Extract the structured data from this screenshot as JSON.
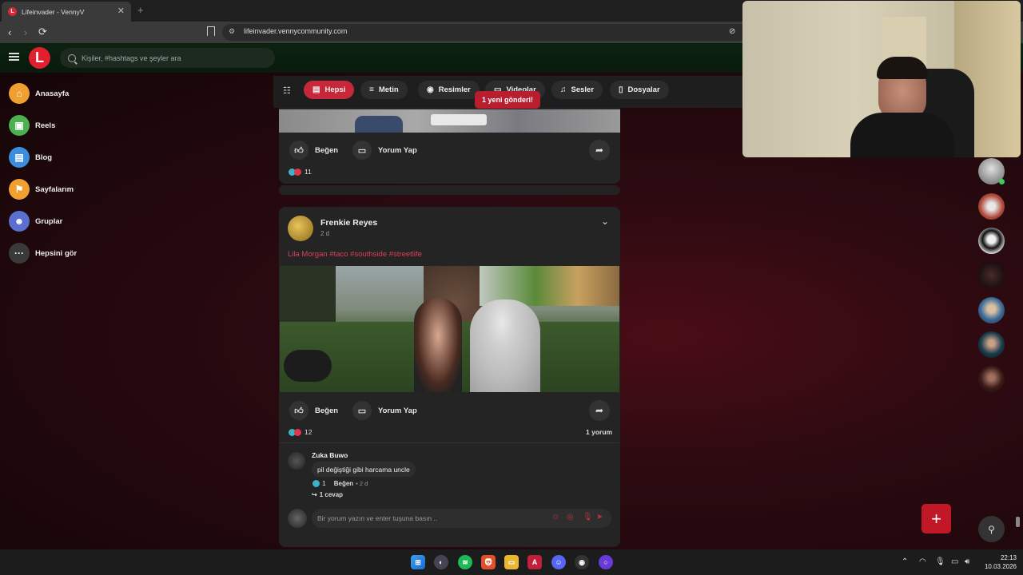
{
  "browser": {
    "tab_title": "Lifeinvader - VennyV",
    "tab_close": "✕",
    "new_tab": "+",
    "url": "lifeinvader.vennycommunity.com"
  },
  "header": {
    "logo": "L",
    "search_placeholder": "Kişiler, #hashtags ve şeyler ara"
  },
  "sidebar": {
    "items": [
      {
        "label": "Anasayfa",
        "icon": "home-icon",
        "color": "#f0a030"
      },
      {
        "label": "Reels",
        "icon": "reels-icon",
        "color": "#4caf50"
      },
      {
        "label": "Blog",
        "icon": "blog-icon",
        "color": "#3b8de0"
      },
      {
        "label": "Sayfalarım",
        "icon": "flag-icon",
        "color": "#f0a030"
      },
      {
        "label": "Gruplar",
        "icon": "groups-icon",
        "color": "#5b6fd0"
      },
      {
        "label": "Hepsini gör",
        "icon": "more-icon",
        "color": "#3a3a3a"
      }
    ]
  },
  "filters": {
    "chips": [
      {
        "label": "Hepsi",
        "icon": "▤"
      },
      {
        "label": "Metin",
        "icon": "≡"
      },
      {
        "label": "Resimler",
        "icon": "◉"
      },
      {
        "label": "Videolar",
        "icon": "▭"
      },
      {
        "label": "Sesler",
        "icon": "♫"
      },
      {
        "label": "Dosyalar",
        "icon": "▯"
      }
    ],
    "new_post_notice": "1 yeni gönderi!"
  },
  "post1": {
    "like_label": "Beğen",
    "comment_label": "Yorum Yap",
    "reaction_count": "11"
  },
  "post2": {
    "author": "Frenkie Reyes",
    "time": "2 d",
    "text": "Lila Morgan #taco #southside #streetlife",
    "like_label": "Beğen",
    "comment_label": "Yorum Yap",
    "reaction_count": "12",
    "comment_count": "1 yorum",
    "comment": {
      "author": "Zuka Buwo",
      "text": "pil değiştiği gibi harcama uncle",
      "likes": "1",
      "like_label": "Beğen",
      "time": "• 2 d",
      "replies": "1 cevap"
    },
    "comment_placeholder": "Bir yorum yazın ve enter tuşuna basın .."
  },
  "taskbar": {
    "time": "22:13",
    "date": "10.03.2026"
  },
  "colors": {
    "accent": "#c62839",
    "card": "#242424"
  }
}
